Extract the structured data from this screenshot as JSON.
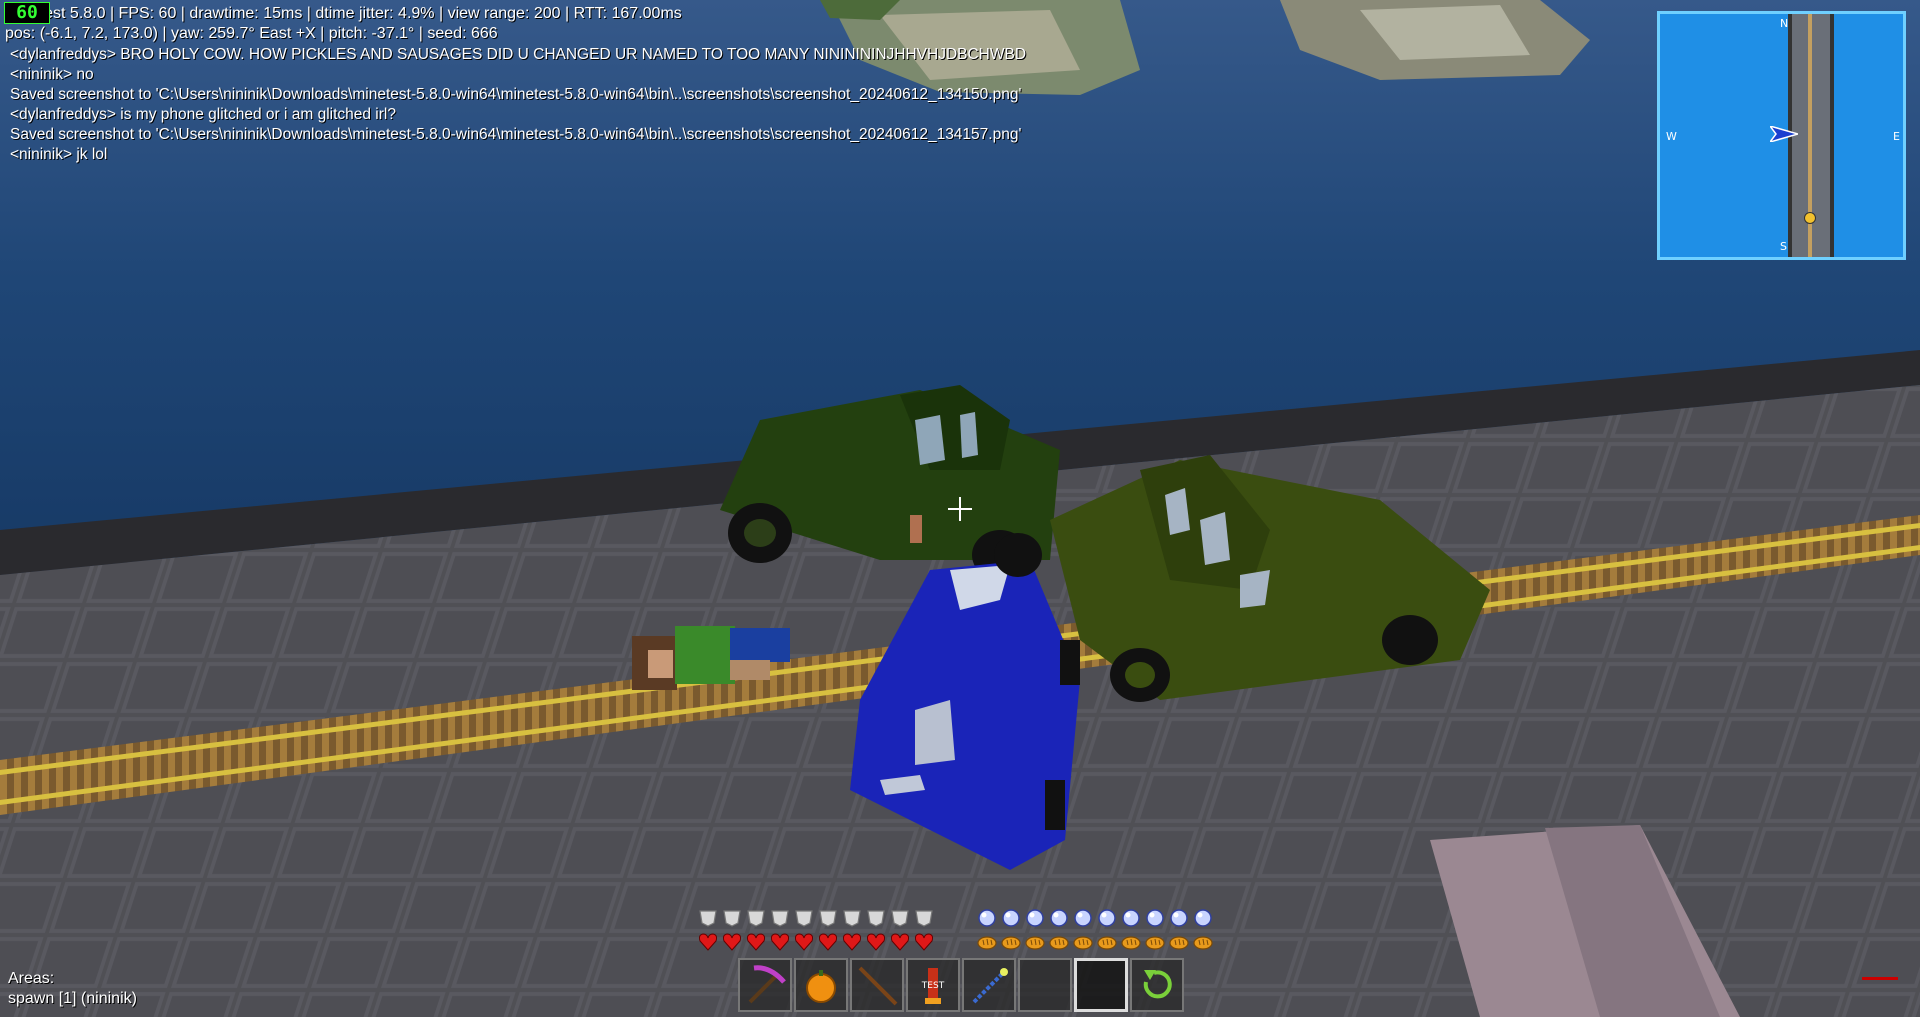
{
  "fps_counter": "60",
  "debug": {
    "line1": "Minetest 5.8.0 | FPS: 60 | drawtime: 15ms | dtime jitter: 4.9% | view range: 200 | RTT: 167.00ms",
    "line2": "pos: (-6.1, 7.2, 173.0) | yaw: 259.7° East +X | pitch: -37.1° | seed: 666"
  },
  "chat": [
    "<dylanfreddys> BRO HOLY COW. HOW PICKLES AND SAUSAGES DID U CHANGED UR NAMED TO TOO MANY NININININJHHVHJDBCHWBD",
    "<nininik> no",
    "Saved screenshot to 'C:\\Users\\nininik\\Downloads\\minetest-5.8.0-win64\\minetest-5.8.0-win64\\bin\\..\\screenshots\\screenshot_20240612_134150.png'",
    "<dylanfreddys> is my phone glitched or i am glitched irl?",
    "Saved screenshot to 'C:\\Users\\nininik\\Downloads\\minetest-5.8.0-win64\\minetest-5.8.0-win64\\bin\\..\\screenshots\\screenshot_20240612_134157.png'",
    "<nininik> jk lol"
  ],
  "minimap": {
    "north": "N",
    "south": "S",
    "east": "E",
    "west": "W"
  },
  "hud": {
    "armor": 10,
    "health": 10,
    "breath": 10,
    "hunger": 10
  },
  "hotbar": {
    "selected": 6,
    "slots": [
      "pickaxe-icon",
      "orange-fruit-icon",
      "stick-icon",
      "test-item-icon",
      "magic-wand-icon",
      "empty-slot",
      "empty-slot",
      "refresh-arrow-icon"
    ],
    "test_label": "TEST"
  },
  "areas": {
    "label": "Areas:",
    "value": "spawn [1] (nininik)"
  },
  "colors": {
    "water": "#1f4a7a",
    "minimap_bg": "#1f8fe6",
    "truck_green": "#23400f",
    "car_blue": "#1a24b8",
    "rail_yellow": "#c9a63a"
  }
}
